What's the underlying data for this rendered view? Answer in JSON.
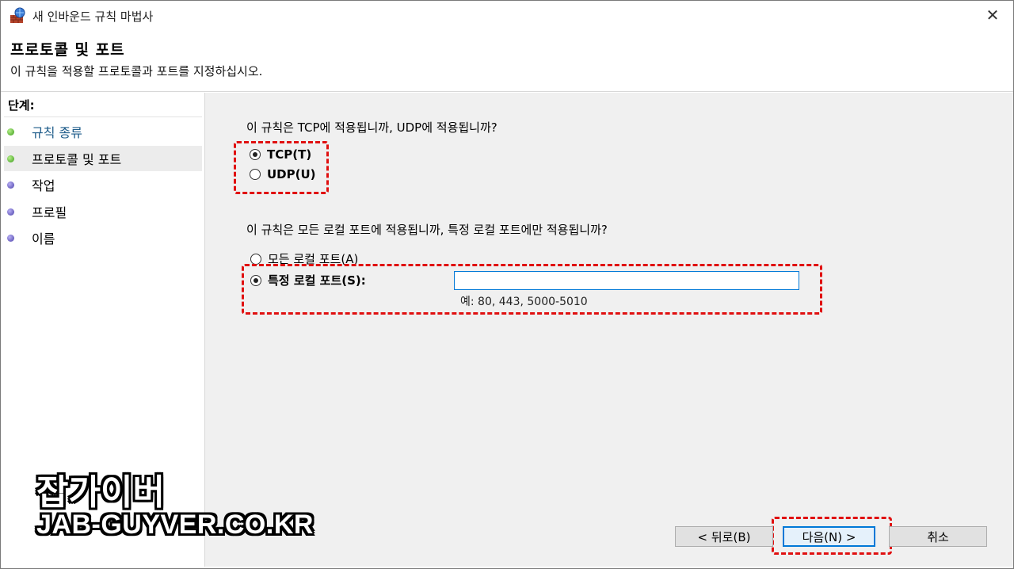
{
  "window": {
    "title": "새 인바운드 규칙 마법사",
    "icon": "firewall-wizard-icon",
    "close_label": "✕"
  },
  "header": {
    "title": "프로토콜 및 포트",
    "description": "이 규칙을 적용할 프로토콜과 포트를 지정하십시오."
  },
  "sidebar": {
    "heading": "단계:",
    "items": [
      {
        "label": "규칙 종류",
        "status": "done"
      },
      {
        "label": "프로토콜 및 포트",
        "status": "current"
      },
      {
        "label": "작업",
        "status": "pending"
      },
      {
        "label": "프로필",
        "status": "pending"
      },
      {
        "label": "이름",
        "status": "pending"
      }
    ]
  },
  "main": {
    "protocol_question": "이 규칙은 TCP에 적용됩니까, UDP에 적용됩니까?",
    "tcp_label": "TCP(T)",
    "udp_label": "UDP(U)",
    "selected_protocol": "TCP",
    "port_question": "이 규칙은 모든 로컬 포트에 적용됩니까, 특정 로컬 포트에만 적용됩니까?",
    "all_ports_label": "모든 로컬 포트(A)",
    "specific_ports_label": "특정 로컬 포트(S):",
    "selected_port_option": "specific",
    "port_value": "",
    "port_example": "예: 80, 443, 5000-5010"
  },
  "buttons": {
    "back": "< 뒤로(B)",
    "next": "다음(N) >",
    "cancel": "취소"
  },
  "watermark": {
    "line1": "잡가이버",
    "line2": "JAB-GUYVER.CO.KR"
  },
  "colors": {
    "highlight_dash": "#e01010",
    "accent": "#0078d7"
  }
}
